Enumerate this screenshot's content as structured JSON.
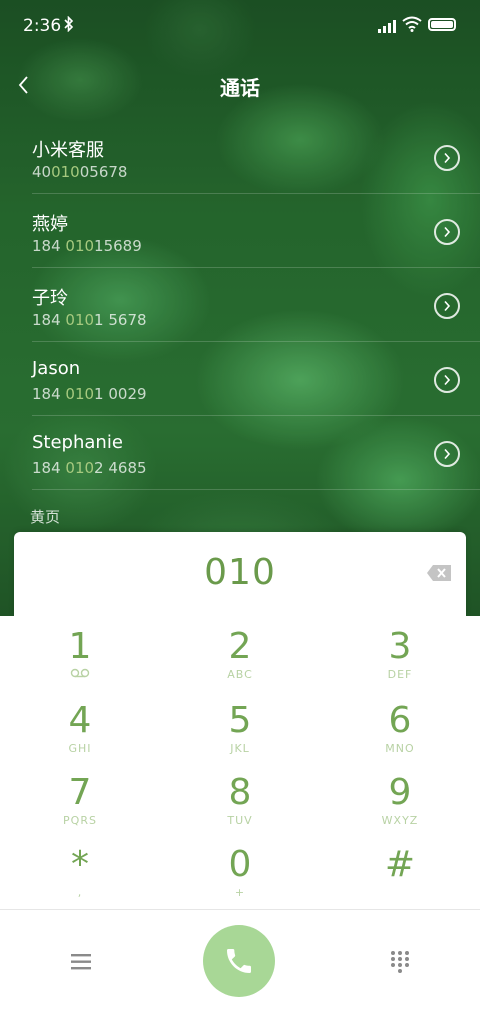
{
  "status_bar": {
    "time": "2:36"
  },
  "header": {
    "back_glyph": "<",
    "title": "通话"
  },
  "contacts": [
    {
      "name": "小米客服",
      "number_pre": "40",
      "number_hl": "010",
      "number_post": "05678"
    },
    {
      "name": "燕婷",
      "number_pre": "184 ",
      "number_hl": "010",
      "number_post": "15689"
    },
    {
      "name": "子玲",
      "number_pre": "184 ",
      "number_hl": "010",
      "number_post": "1 5678"
    },
    {
      "name": "Jason",
      "number_pre": "184 ",
      "number_hl": "010",
      "number_post": "1 0029"
    },
    {
      "name": "Stephanie",
      "number_pre": "184 ",
      "number_hl": "010",
      "number_post": "2 4685"
    }
  ],
  "section_label": "黄页",
  "display": {
    "digits": "010"
  },
  "keypad": [
    {
      "digit": "1",
      "letters": "voicemail-icon"
    },
    {
      "digit": "2",
      "letters": "ABC"
    },
    {
      "digit": "3",
      "letters": "DEF"
    },
    {
      "digit": "4",
      "letters": "GHI"
    },
    {
      "digit": "5",
      "letters": "JKL"
    },
    {
      "digit": "6",
      "letters": "MNO"
    },
    {
      "digit": "7",
      "letters": "PQRS"
    },
    {
      "digit": "8",
      "letters": "TUV"
    },
    {
      "digit": "9",
      "letters": "WXYZ"
    },
    {
      "digit": "*",
      "letters": ","
    },
    {
      "digit": "0",
      "letters": "+"
    },
    {
      "digit": "#",
      "letters": ""
    }
  ],
  "colors": {
    "accent": "#73a554",
    "call_button": "#a8d796",
    "highlight": "#a6c97f"
  },
  "icons": {
    "back": "chevron-left-icon",
    "detail": "chevron-right-circle-icon",
    "backspace": "backspace-icon",
    "menu": "menu-icon",
    "call": "phone-icon",
    "dialpad": "dialpad-icon"
  }
}
